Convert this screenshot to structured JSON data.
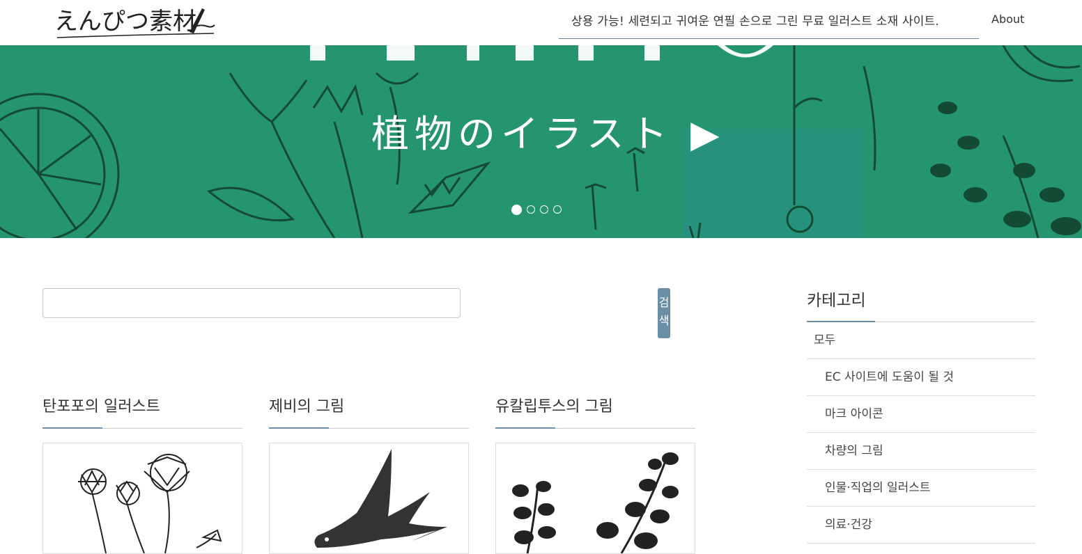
{
  "header": {
    "logo_text": "えんぴつ素材",
    "tagline": "상용 가능! 세련되고 귀여운 연필 손으로 그린 무료 일러스트 소재 사이트.",
    "about_label": "About"
  },
  "hero": {
    "title": "植物のイラスト ▶",
    "slide_count": 4,
    "active_slide": 1
  },
  "search": {
    "placeholder": "",
    "value": "",
    "button_label": "검색"
  },
  "cards": [
    {
      "title": "탄포포의 일러스트",
      "image": "dandelion-illustration"
    },
    {
      "title": "제비의 그림",
      "image": "swallow-illustration"
    },
    {
      "title": "유칼립투스의 그림",
      "image": "eucalyptus-illustration"
    }
  ],
  "sidebar": {
    "title": "카테고리",
    "items": [
      {
        "label": "모두"
      },
      {
        "label": "EC 사이트에 도움이 될 것"
      },
      {
        "label": "마크 아이콘"
      },
      {
        "label": "차량의 그림"
      },
      {
        "label": "인물·직업의 일러스트"
      },
      {
        "label": "의료·건강"
      }
    ]
  },
  "colors": {
    "hero_green": "#25956f",
    "accent": "#6a8ea3"
  }
}
